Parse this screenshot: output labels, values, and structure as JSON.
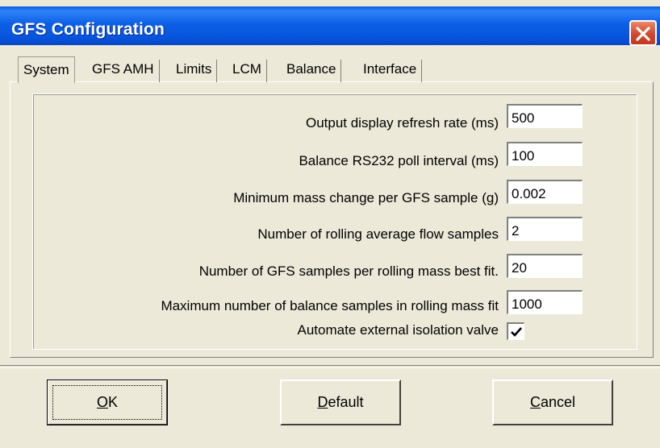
{
  "window": {
    "title": "GFS Configuration"
  },
  "tabs": [
    {
      "label": "System",
      "selected": true
    },
    {
      "label": "GFS AMH",
      "selected": false
    },
    {
      "label": "Limits",
      "selected": false
    },
    {
      "label": "LCM",
      "selected": false
    },
    {
      "label": "Balance",
      "selected": false
    },
    {
      "label": "Interface",
      "selected": false
    }
  ],
  "settings": [
    {
      "label": "Output display refresh rate (ms)",
      "value": "500"
    },
    {
      "label": "Balance RS232 poll interval (ms)",
      "value": "100"
    },
    {
      "label": "Minimum mass change per GFS sample (g)",
      "value": "0.002"
    },
    {
      "label": "Number of rolling average flow samples",
      "value": "2"
    },
    {
      "label": "Number of GFS samples per rolling mass best fit.",
      "value": "20"
    },
    {
      "label": "Maximum number of balance samples in rolling mass fit",
      "value": "1000"
    }
  ],
  "isolation_valve": {
    "label": "Automate external isolation valve",
    "checked": true
  },
  "buttons": {
    "ok_access": "O",
    "ok_rest": "K",
    "default_access": "D",
    "default_rest": "efault",
    "cancel_access": "C",
    "cancel_rest": "ancel"
  },
  "colors": {
    "titlebar": "#0855dd",
    "close": "#d2472b",
    "face": "#ece9d8"
  }
}
